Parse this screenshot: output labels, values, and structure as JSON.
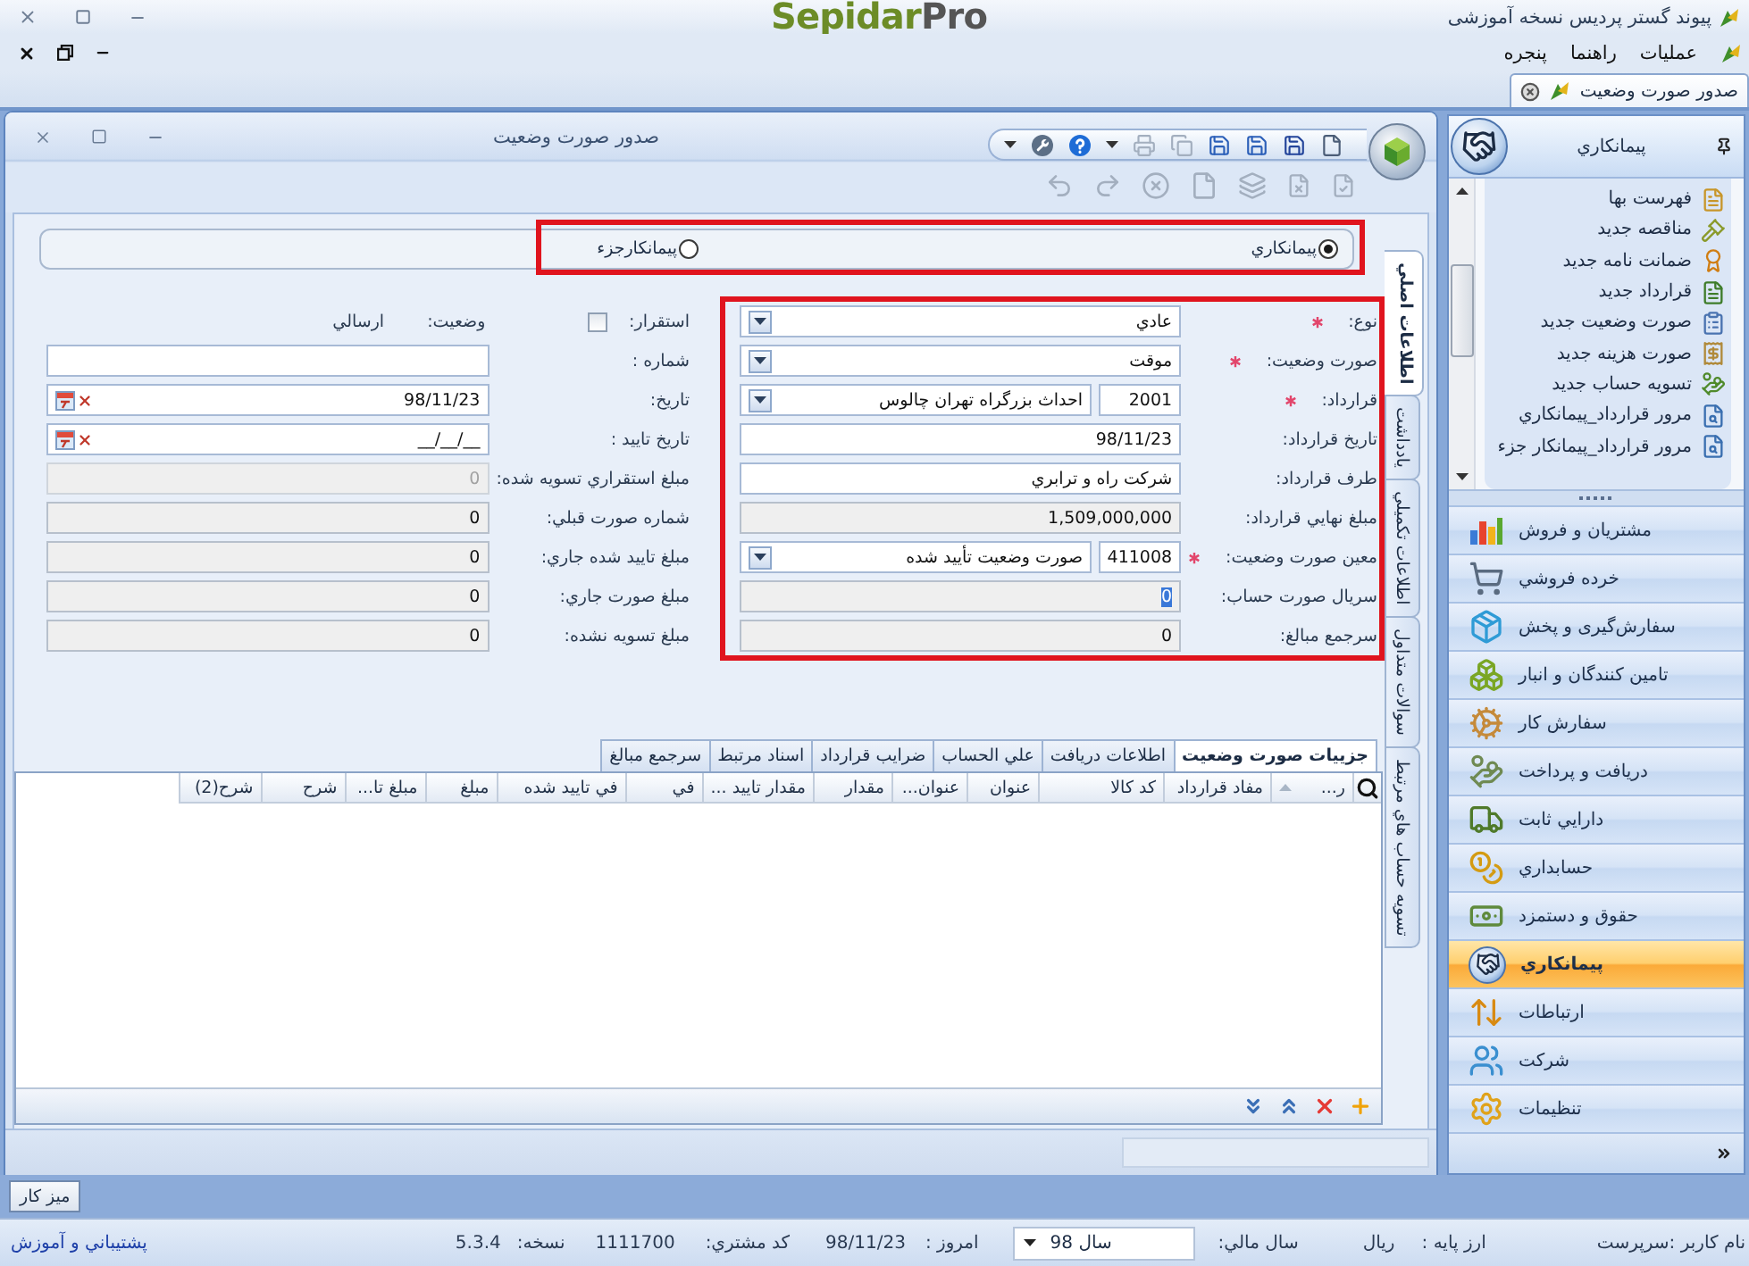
{
  "app_title": "پیوند گستر پردیس نسخه آموزشی",
  "logo": {
    "primary": "Sepidar",
    "secondary": "Pro"
  },
  "menu": [
    {
      "label": "عملیات"
    },
    {
      "label": "راهنما"
    },
    {
      "label": "پنجره"
    }
  ],
  "document_tabs": [
    {
      "label": "صدور صورت وضعیت",
      "selected": true
    }
  ],
  "form_window": {
    "title": "صدور صورت وضعیت"
  },
  "contractor_type": {
    "highlighted": true,
    "options": [
      {
        "label": "پیمانکاري",
        "selected": true
      },
      {
        "label": "پیمانکارجزء",
        "selected": false
      }
    ]
  },
  "side_tabs": [
    {
      "label": "اطلاعات اصلي",
      "selected": true
    },
    {
      "label": "یادداشت",
      "selected": false
    },
    {
      "label": "اطلاعات تکمیلي",
      "selected": false
    },
    {
      "label": "سوالات متداول",
      "selected": false
    },
    {
      "label": "تسویه حساب هاي مرتبط",
      "selected": false
    }
  ],
  "settlement": {
    "label": "استقرار:",
    "checked": false
  },
  "status": {
    "label": "وضعیت:",
    "value": "ارسالي"
  },
  "left_fields": [
    {
      "kind": "text",
      "label": "شماره :",
      "readonly": false,
      "disabled": false
    },
    {
      "kind": "date",
      "label": "تاریخ:",
      "value": "98/11/23",
      "readonly": false,
      "disabled": false
    },
    {
      "kind": "date",
      "label": "تاریخ تایید :",
      "value": "__/__/__",
      "readonly": false,
      "disabled": false
    },
    {
      "kind": "text",
      "label": "مبلغ استقراري تسویه شده:",
      "value": "0",
      "readonly": true,
      "disabled": true
    },
    {
      "kind": "text",
      "label": "شماره صورت قبلي:",
      "value": "0",
      "readonly": true,
      "disabled": false
    },
    {
      "kind": "text",
      "label": "مبلغ تایید شده جاري:",
      "value": "0",
      "readonly": true,
      "disabled": false
    },
    {
      "kind": "text",
      "label": "مبلغ صورت جاري:",
      "value": "0",
      "readonly": true,
      "disabled": false
    },
    {
      "kind": "text",
      "label": "مبلغ تسویه نشده:",
      "value": "0",
      "readonly": true,
      "disabled": false
    }
  ],
  "right_fields": {
    "highlighted": true,
    "rows": [
      {
        "kind": "select",
        "label": "نوع:",
        "required": true,
        "value": "عادي",
        "readonly": false,
        "focused": false
      },
      {
        "kind": "select",
        "label": "صورت وضعیت:",
        "required": true,
        "value": "موقت",
        "readonly": false,
        "focused": false
      },
      {
        "kind": "lookup",
        "label": "قرارداد:",
        "required": true,
        "code": "2001",
        "value": "احداث بزرگراه تهران چالوس",
        "readonly": false,
        "focused": false
      },
      {
        "kind": "text",
        "label": "تاریخ قرارداد:",
        "required": false,
        "value": "98/11/23",
        "readonly": false,
        "focused": false
      },
      {
        "kind": "text",
        "label": "طرف قرارداد:",
        "required": false,
        "value": "شرکت راه و ترابري",
        "readonly": false,
        "focused": false
      },
      {
        "kind": "text",
        "label": "مبلغ نهایي قرارداد:",
        "required": false,
        "value": "1,509,000,000",
        "readonly": true,
        "focused": false
      },
      {
        "kind": "lookup",
        "label": "معین صورت وضعیت:",
        "required": true,
        "code": "411008",
        "value": "صورت وضعیت تأیید شده",
        "readonly": false,
        "focused": false
      },
      {
        "kind": "text",
        "label": "سریال صورت حساب:",
        "required": false,
        "value": "0",
        "readonly": true,
        "focused": true
      },
      {
        "kind": "text",
        "label": "سرجمع مبالغ:",
        "required": false,
        "value": "0",
        "readonly": true,
        "focused": false
      }
    ]
  },
  "detail_tabs": [
    {
      "label": "جزییات صورت وضعیت",
      "selected": true
    },
    {
      "label": "اطلاعات دریافت",
      "selected": false
    },
    {
      "label": "علي الحساب",
      "selected": false
    },
    {
      "label": "ضرایب قرارداد",
      "selected": false
    },
    {
      "label": "اسناد مرتبط",
      "selected": false
    },
    {
      "label": "سرجمع مبالغ",
      "selected": false
    }
  ],
  "grid": {
    "columns": [
      {
        "label": "ر...",
        "sorted": true
      },
      {
        "label": "مفاد قرارداد",
        "sorted": false
      },
      {
        "label": "کد کالا",
        "sorted": false
      },
      {
        "label": "عنوان",
        "sorted": false
      },
      {
        "label": "عنوان...",
        "sorted": false
      },
      {
        "label": "مقدار",
        "sorted": false
      },
      {
        "label": "مقدار تایید ...",
        "sorted": false
      },
      {
        "label": "في",
        "sorted": false
      },
      {
        "label": "في تایید شده",
        "sorted": false
      },
      {
        "label": "مبلغ",
        "sorted": false
      },
      {
        "label": "مبلغ تا...",
        "sorted": false
      },
      {
        "label": "شرح",
        "sorted": false
      },
      {
        "label": "شرح(2)",
        "sorted": false
      }
    ]
  },
  "taskbar": [
    {
      "label": "میز کار"
    }
  ],
  "sidebar": {
    "title": "پیمانکاري",
    "items": [
      {
        "label": "فهرست بها"
      },
      {
        "label": "مناقصه جدید"
      },
      {
        "label": "ضمانت نامه جدید"
      },
      {
        "label": "قرارداد جدید"
      },
      {
        "label": "صورت وضعیت جدید"
      },
      {
        "label": "صورت هزینه جدید"
      },
      {
        "label": "تسویه حساب جدید"
      },
      {
        "label": "مرور قرارداد_پیمانکاري"
      },
      {
        "label": "مرور قرارداد_پیمانکار جزء"
      }
    ],
    "modules": [
      {
        "label": "مشتریان و فروش",
        "selected": false
      },
      {
        "label": "خرده فروشي",
        "selected": false
      },
      {
        "label": "سفارش‌گیری و پخش",
        "selected": false
      },
      {
        "label": "تامین کنندگان و انبار",
        "selected": false
      },
      {
        "label": "سفارش کار",
        "selected": false
      },
      {
        "label": "دریافت و پرداخت",
        "selected": false
      },
      {
        "label": "دارایي ثابت",
        "selected": false
      },
      {
        "label": "حسابداري",
        "selected": false
      },
      {
        "label": "حقوق و دستمزد",
        "selected": false
      },
      {
        "label": "پیمانکاري",
        "selected": true
      },
      {
        "label": "ارتباطات",
        "selected": false
      },
      {
        "label": "شرکت",
        "selected": false
      },
      {
        "label": "تنظیمات",
        "selected": false
      }
    ]
  },
  "status_bar": {
    "user": "نام کاربر :سرپرست",
    "currency_label": "ارز پایه :",
    "currency": "ریال",
    "fiscal_year_label": "سال مالي:",
    "fiscal_year": "سال 98",
    "today_label": "امروز :",
    "today": "98/11/23",
    "customer_code_label": "کد مشتري:",
    "customer_code": "1111700",
    "version_label": "نسخه:",
    "version": "5.3.4",
    "support_link": "پشتیباني و آموزش"
  }
}
